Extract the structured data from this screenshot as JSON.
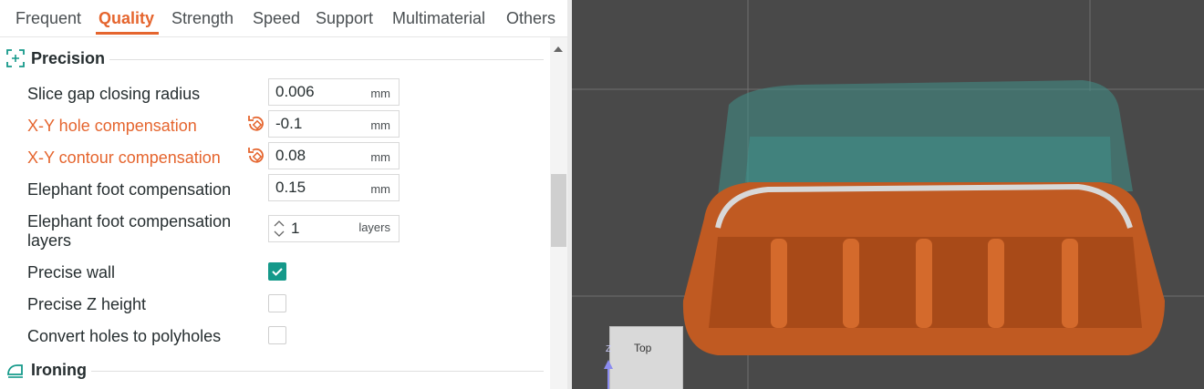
{
  "tabs": [
    {
      "label": "Frequent",
      "active": false
    },
    {
      "label": "Quality",
      "active": true
    },
    {
      "label": "Strength",
      "active": false
    },
    {
      "label": "Speed",
      "active": false
    },
    {
      "label": "Support",
      "active": false
    },
    {
      "label": "Multimaterial",
      "active": false
    },
    {
      "label": "Others",
      "active": false
    }
  ],
  "colors": {
    "accent": "#e5652e",
    "check": "#15998a"
  },
  "sections": {
    "precision": {
      "title": "Precision",
      "icon": "precision-icon"
    },
    "ironing": {
      "title": "Ironing",
      "icon": "iron-icon"
    }
  },
  "settings": {
    "slice_gap": {
      "label": "Slice gap closing radius",
      "value": "0.006",
      "unit": "mm"
    },
    "xy_hole": {
      "label": "X-Y hole compensation",
      "value": "-0.1",
      "unit": "mm"
    },
    "xy_contour": {
      "label": "X-Y contour compensation",
      "value": "0.08",
      "unit": "mm"
    },
    "elephant_foot": {
      "label": "Elephant foot compensation",
      "value": "0.15",
      "unit": "mm"
    },
    "elephant_layers": {
      "label_line1": "Elephant foot compensation",
      "label_line2": "layers",
      "value": "1",
      "unit": "layers"
    },
    "precise_wall": {
      "label": "Precise wall",
      "checked": true
    },
    "precise_z": {
      "label": "Precise Z height",
      "checked": false
    },
    "polyholes": {
      "label": "Convert holes to polyholes",
      "checked": false
    }
  },
  "viewport": {
    "cube_label": "Top",
    "axis_label": "Z"
  }
}
